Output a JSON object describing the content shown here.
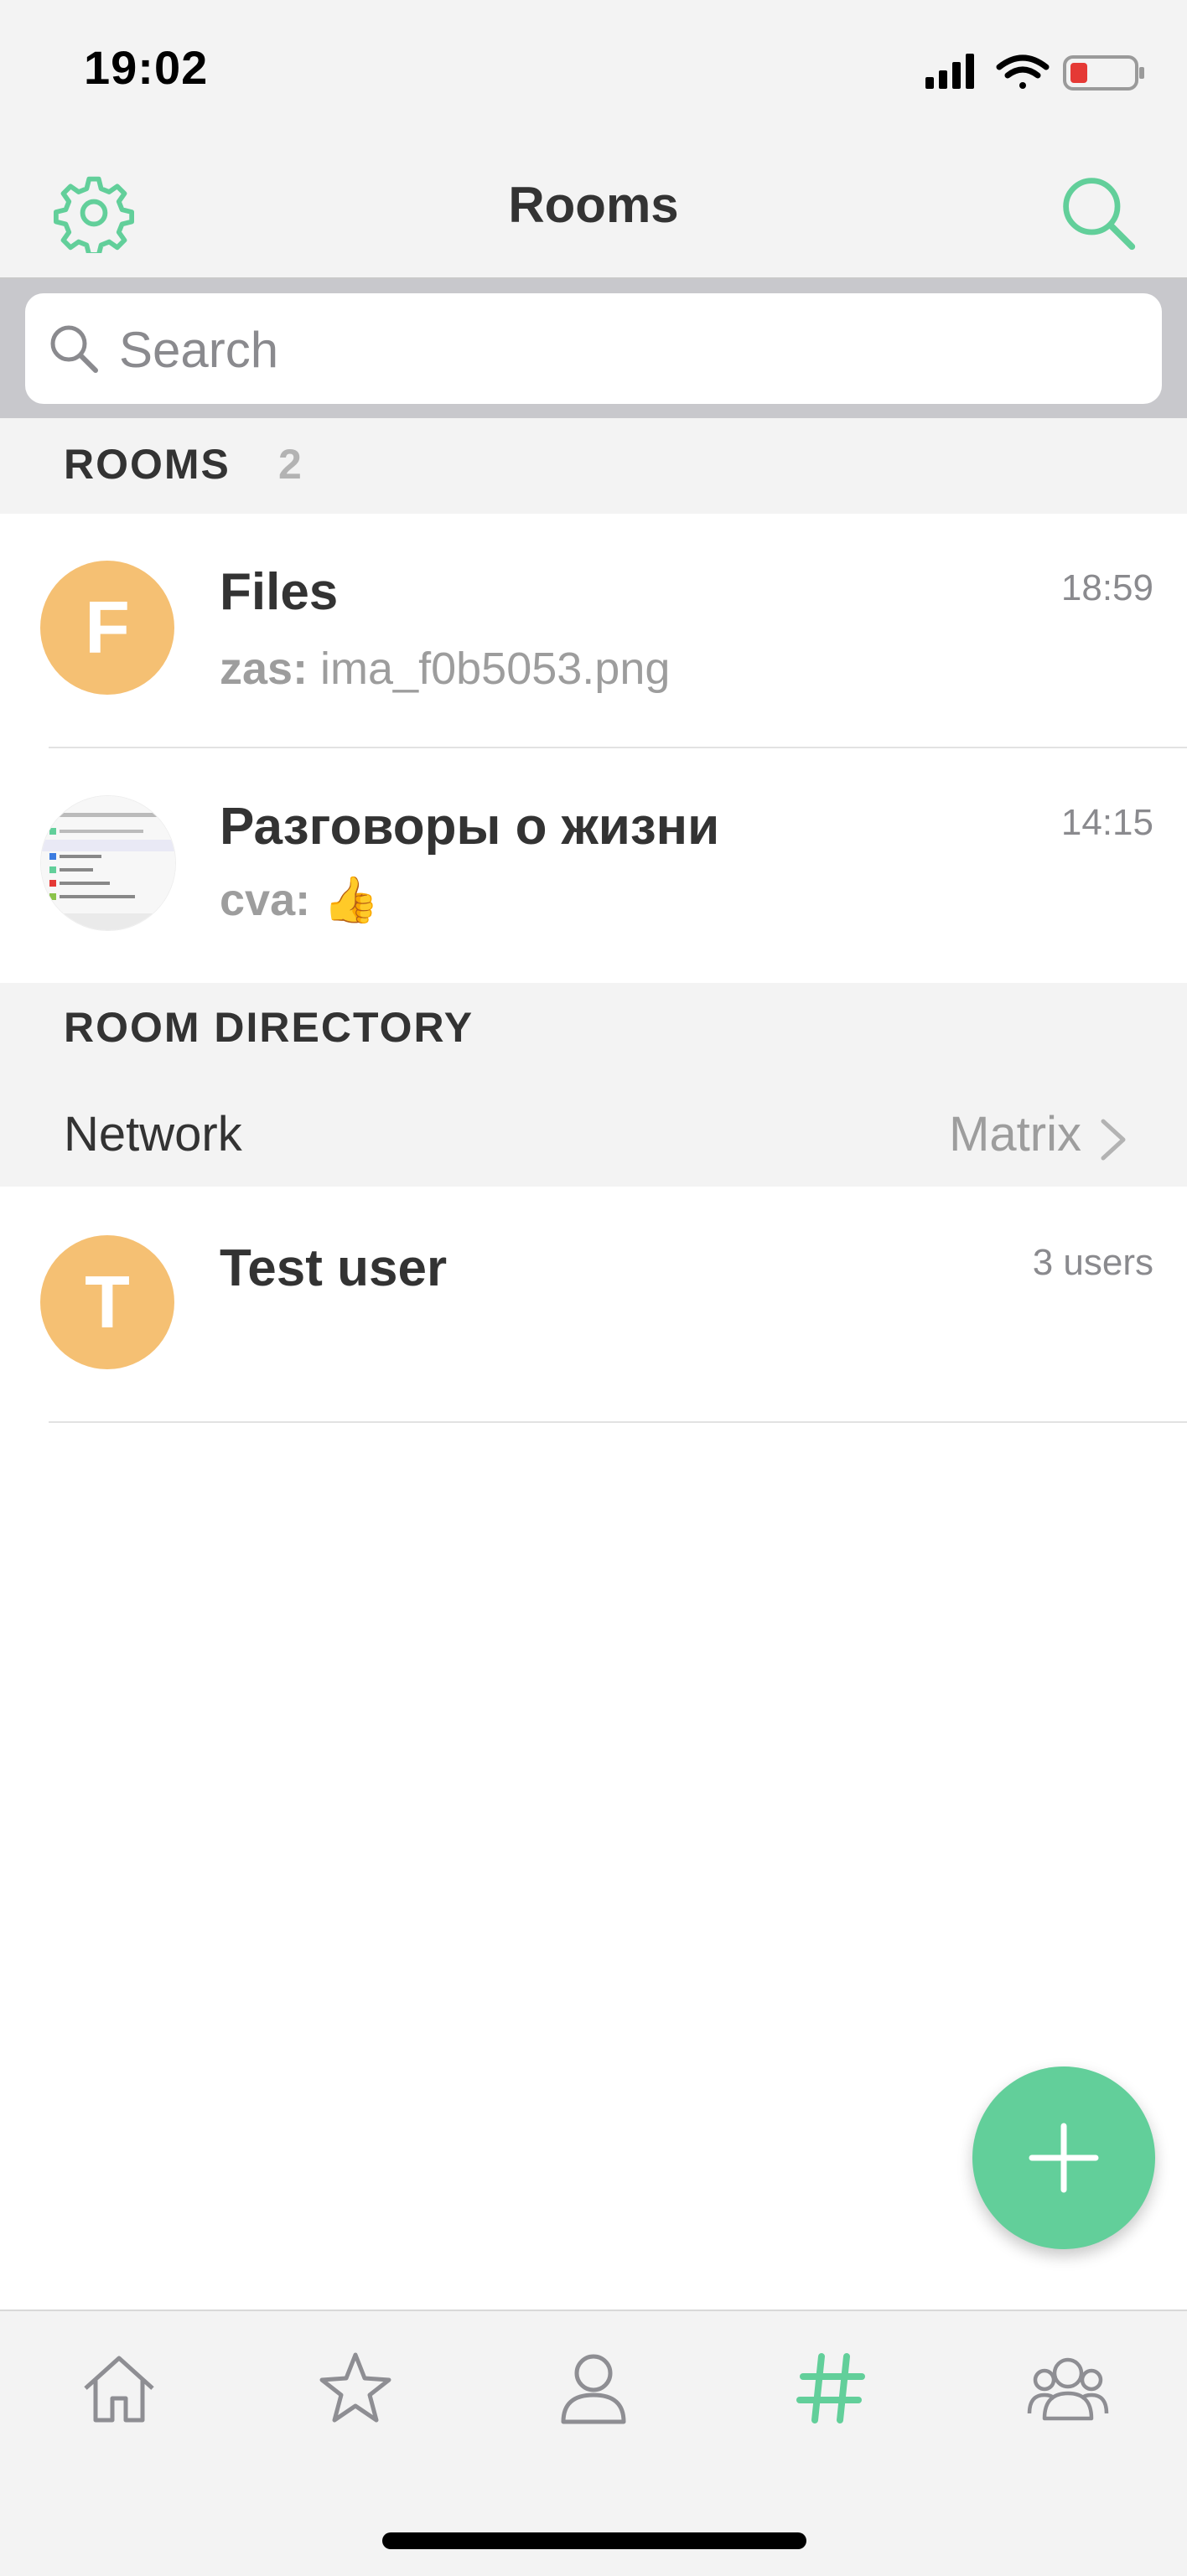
{
  "status_bar": {
    "time": "19:02"
  },
  "nav": {
    "title": "Rooms",
    "settings_icon": "gear-icon",
    "search_icon": "search-icon"
  },
  "search": {
    "placeholder": "Search"
  },
  "rooms_section": {
    "title": "ROOMS",
    "count": "2"
  },
  "rooms": [
    {
      "initial": "F",
      "name": "Files",
      "time": "18:59",
      "sender": "zas:",
      "message": " ima_f0b5053.png"
    },
    {
      "initial": "",
      "name": "Разговоры о жизни",
      "time": "14:15",
      "sender": "cva:",
      "message": " 👍"
    }
  ],
  "directory_section": {
    "title": "ROOM DIRECTORY"
  },
  "network": {
    "label": "Network",
    "value": "Matrix"
  },
  "directory_rooms": [
    {
      "initial": "T",
      "name": "Test user",
      "members": "3 users"
    }
  ],
  "tabs": [
    "home-icon",
    "favourites-icon",
    "people-icon",
    "rooms-icon",
    "groups-icon"
  ],
  "colors": {
    "accent": "#62cf9a",
    "avatar": "#f5c073"
  }
}
